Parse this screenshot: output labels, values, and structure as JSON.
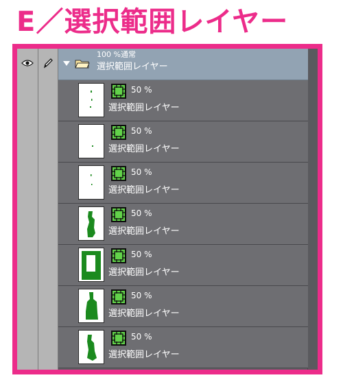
{
  "heading": "E／選択範囲レイヤー",
  "colors": {
    "accent": "#ec2c8a",
    "panel_bg": "#6e6e72",
    "folder_row": "#92a3b3",
    "mask_green": "#62d24a",
    "art_green": "#1b8a1e"
  },
  "header_icons": {
    "visibility": "eye-icon",
    "edit": "pen-icon"
  },
  "folder": {
    "icon": "folder-icon",
    "mode_line": "100 %通常",
    "name": "選択範囲レイヤー"
  },
  "layers": [
    {
      "opacity": "50 %",
      "name": "選択範囲レイヤー"
    },
    {
      "opacity": "50 %",
      "name": "選択範囲レイヤー"
    },
    {
      "opacity": "50 %",
      "name": "選択範囲レイヤー"
    },
    {
      "opacity": "50 %",
      "name": "選択範囲レイヤー"
    },
    {
      "opacity": "50 %",
      "name": "選択範囲レイヤー"
    },
    {
      "opacity": "50 %",
      "name": "選択範囲レイヤー"
    },
    {
      "opacity": "50 %",
      "name": "選択範囲レイヤー"
    }
  ]
}
